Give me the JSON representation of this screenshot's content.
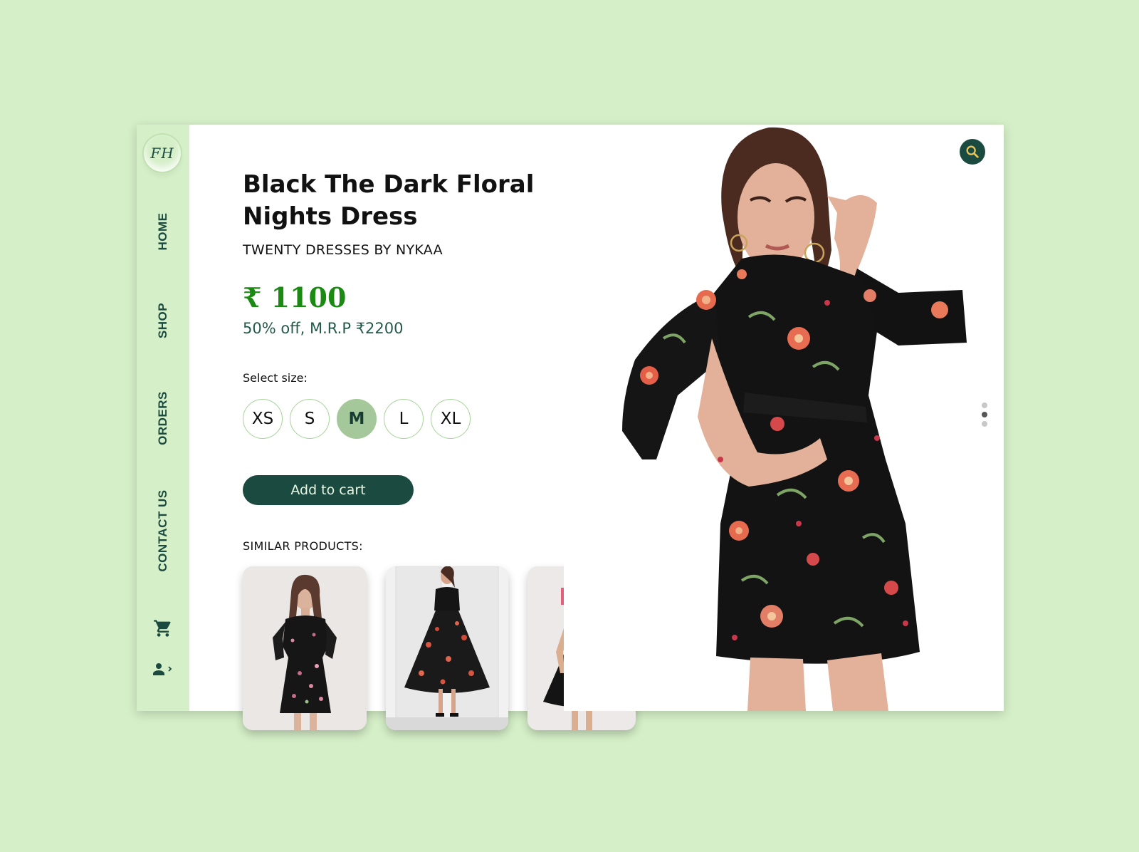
{
  "logo": {
    "text": "FH"
  },
  "nav": {
    "home": "HOME",
    "shop": "SHOP",
    "orders": "ORDERS",
    "contact": "CONTACT US"
  },
  "icons": {
    "cart": "cart-icon",
    "account": "account-icon",
    "search": "search-icon"
  },
  "product": {
    "title": "Black The Dark Floral Nights Dress",
    "brand": "TWENTY DRESSES BY NYKAA",
    "price": "₹ 1100",
    "discount": "50% off, M.R.P ₹2200"
  },
  "size_selector": {
    "label": "Select size:",
    "options": [
      "XS",
      "S",
      "M",
      "L",
      "XL"
    ],
    "selected": "M"
  },
  "add_to_cart_label": "Add to cart",
  "similar": {
    "label": "SIMILAR PRODUCTS:"
  },
  "carousel": {
    "count": 3,
    "active_index": 1
  },
  "colors": {
    "background": "#d5efc8",
    "primary": "#1b4b40",
    "price": "#1b8a12",
    "size_selected": "#a5c89a",
    "size_border": "#a6d39a"
  }
}
